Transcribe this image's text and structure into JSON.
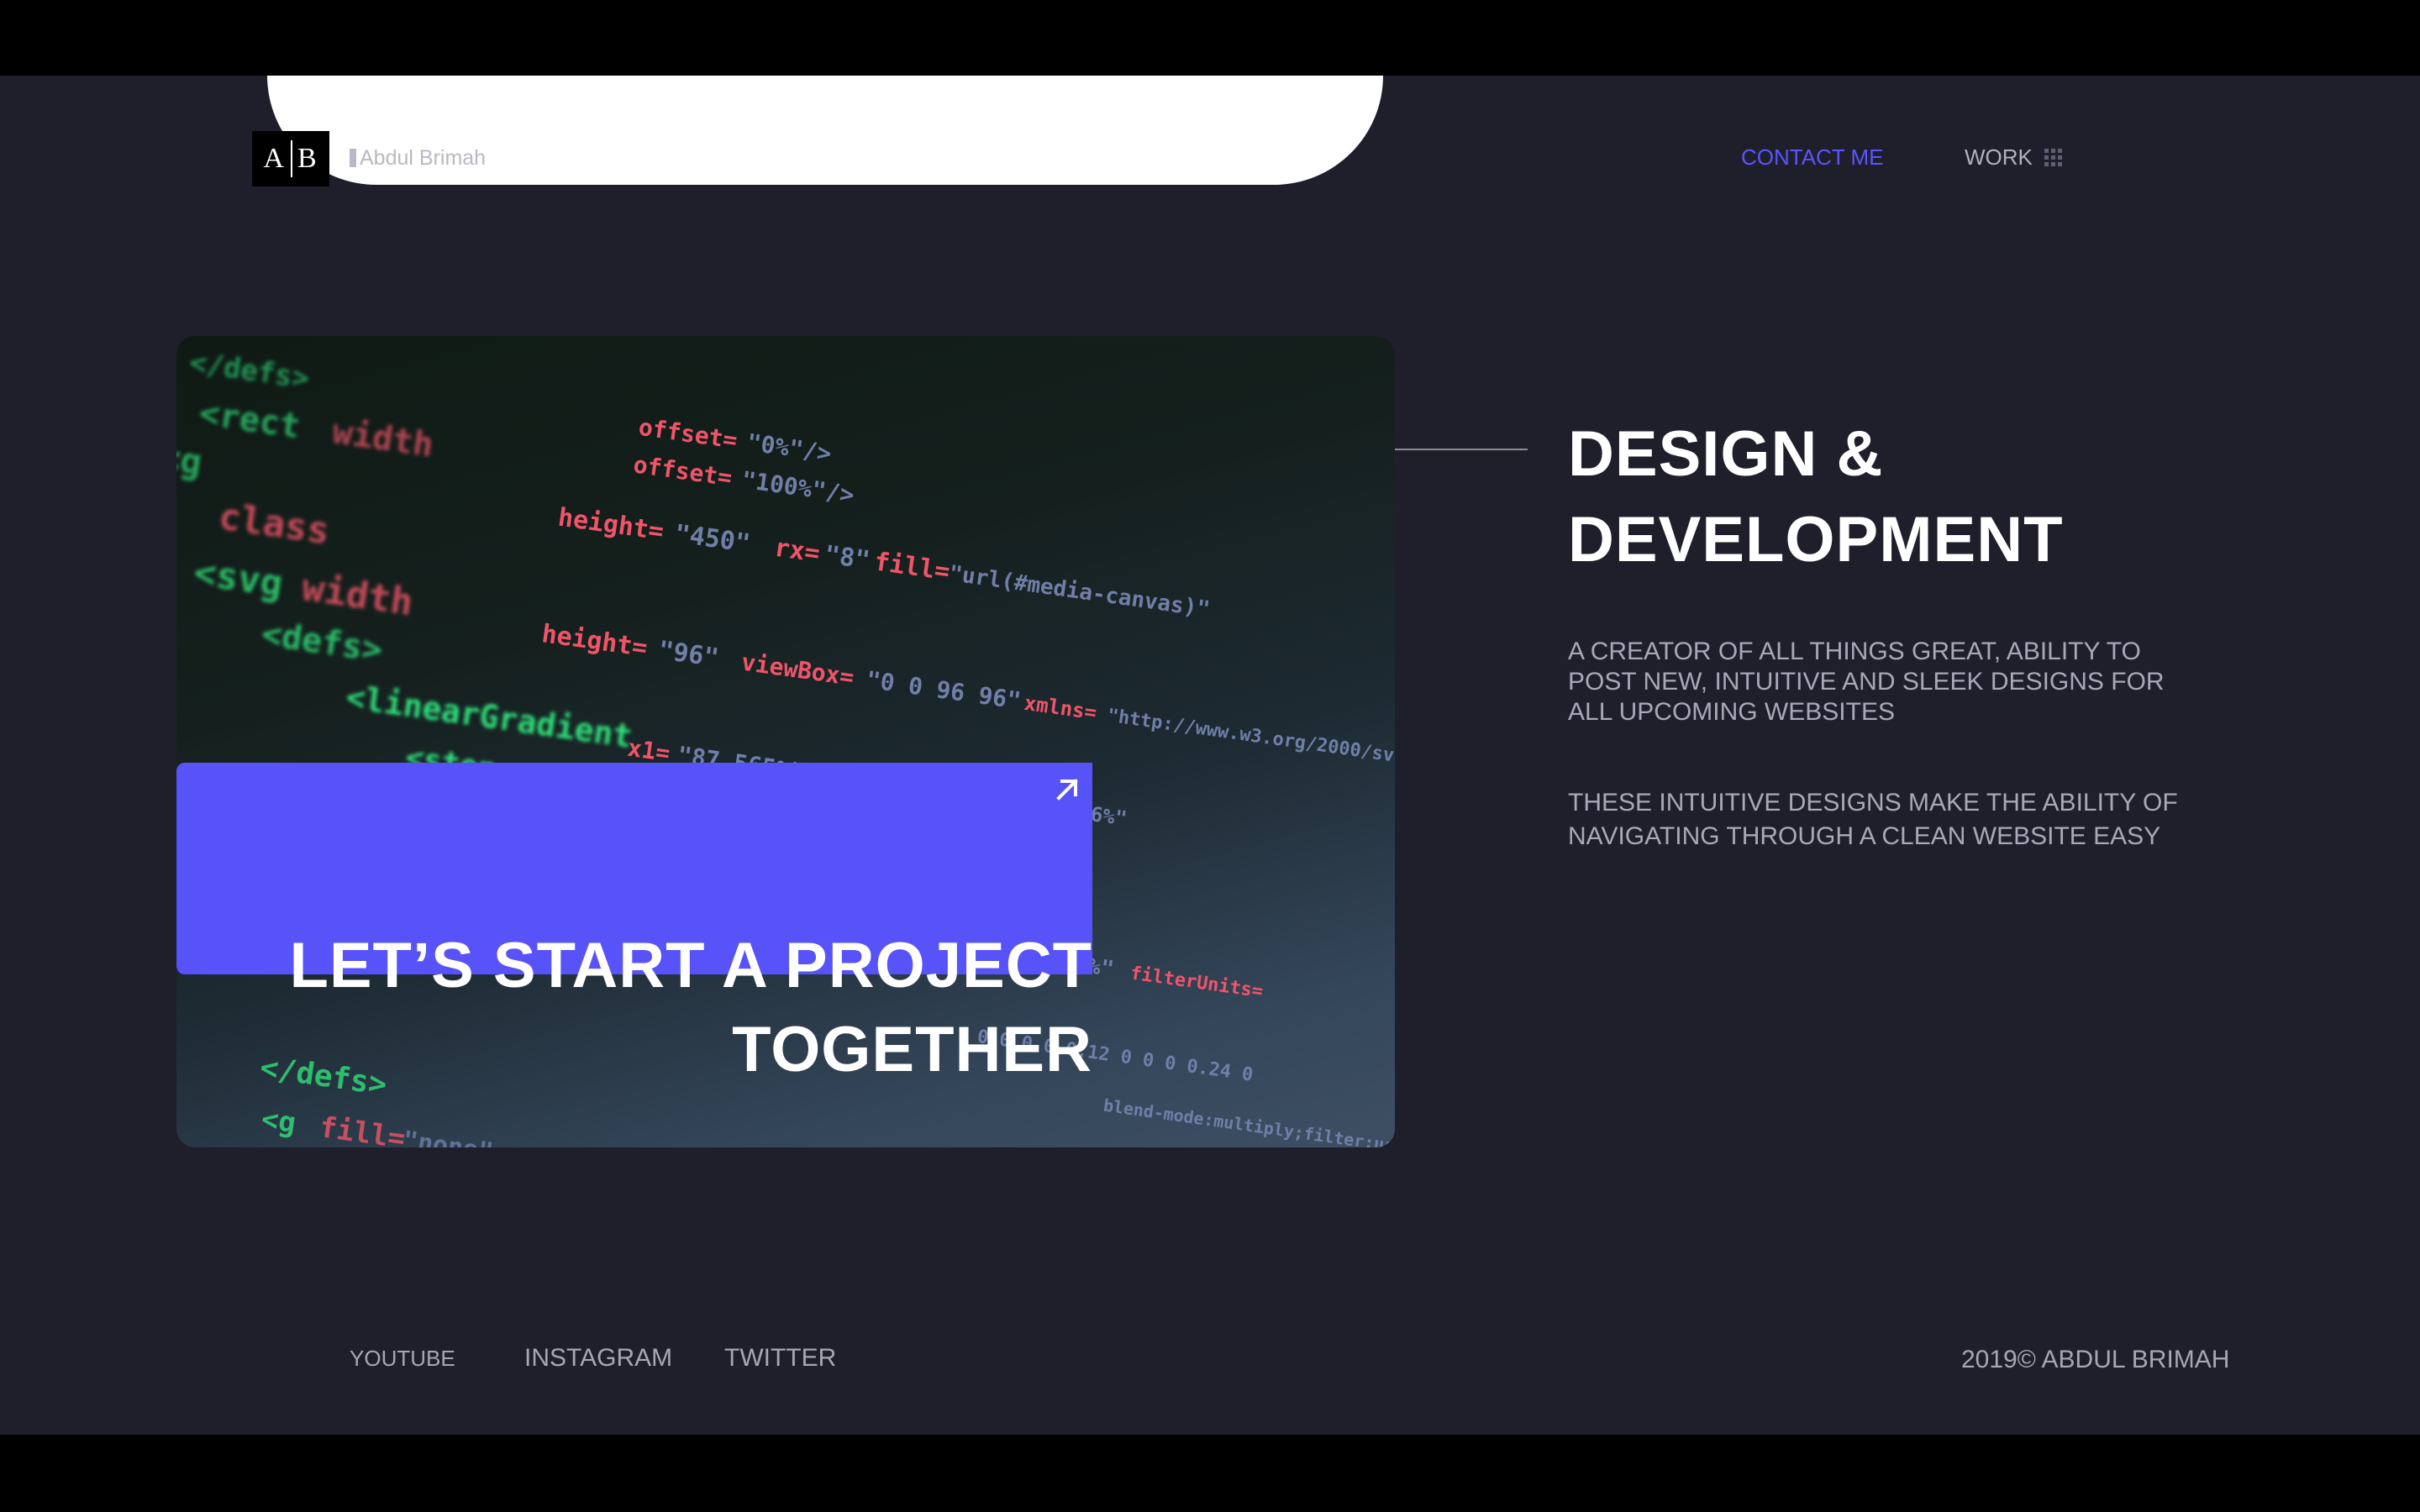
{
  "header": {
    "logo_left": "A",
    "logo_right": "B",
    "brand_name": "Abdul Brimah",
    "nav_contact": "CONTACT ME",
    "nav_work": "WORK"
  },
  "hero": {
    "cta_line1": "LET’S START A PROJECT",
    "cta_line2": "TOGETHER"
  },
  "main": {
    "heading_line1": "DESIGN &",
    "heading_line2": "DEVELOPMENT",
    "paragraph1": "A CREATOR OF ALL THINGS GREAT, ABILITY TO POST NEW, INTUITIVE AND SLEEK DESIGNS FOR ALL UPCOMING WEBSITES",
    "paragraph2": "THESE INTUITIVE DESIGNS MAKE THE ABILITY OF NAVIGATING THROUGH A CLEAN WEBSITE EASY"
  },
  "footer": {
    "links": [
      "YOUTUBE",
      "INSTAGRAM",
      "TWITTER"
    ],
    "copyright": "2019© ABDUL BRIMAH"
  },
  "colors": {
    "accent": "#5753f8",
    "background": "#1f1f2b",
    "nav_active": "#5a55ff"
  },
  "icons": [
    "arrow-up-right-icon",
    "grid-icon"
  ]
}
